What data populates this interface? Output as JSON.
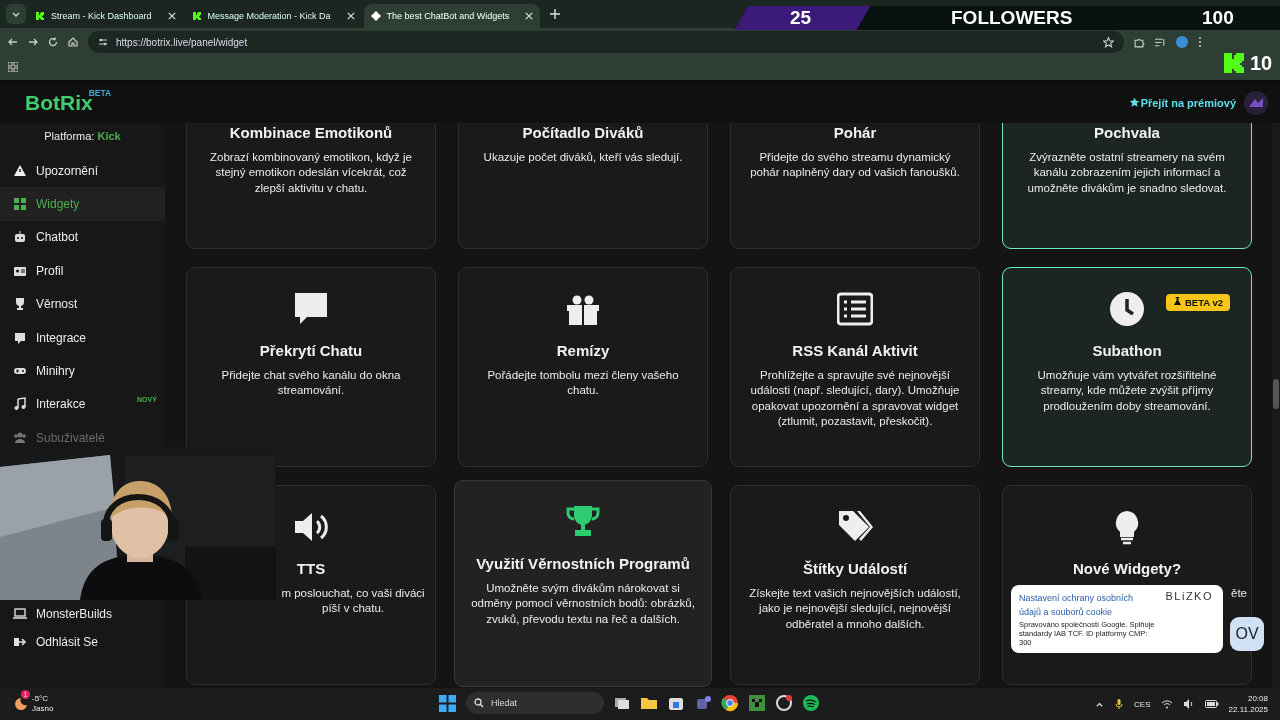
{
  "browser": {
    "tabs": [
      {
        "title": "Stream - Kick Dashboard",
        "selected": false
      },
      {
        "title": "Message Moderation - Kick Da",
        "selected": false
      },
      {
        "title": "The best ChatBot and Widgets",
        "selected": true
      }
    ],
    "url": "https://botrix.live/panel/widget"
  },
  "follower_goal": {
    "current": "25",
    "label": "FOLLOWERS",
    "target": "100",
    "level": 0.25
  },
  "kick_counter": {
    "value": "10"
  },
  "header": {
    "logo": "BotRix",
    "logo_badge": "BETA",
    "premium_link": "Přejít na prémiový"
  },
  "sidebar": {
    "platform_label": "Platforma:",
    "platform": "Kick",
    "items": [
      {
        "label": "Upozornění",
        "selected": false,
        "disabled": false
      },
      {
        "label": "Widgety",
        "selected": true,
        "disabled": false
      },
      {
        "label": "Chatbot",
        "selected": false,
        "disabled": false
      },
      {
        "label": "Profil",
        "selected": false,
        "disabled": false
      },
      {
        "label": "Věrnost",
        "selected": false,
        "disabled": false
      },
      {
        "label": "Integrace",
        "selected": false,
        "disabled": false
      },
      {
        "label": "Minihry",
        "selected": false,
        "disabled": false
      },
      {
        "label": "Interakce",
        "selected": false,
        "disabled": false,
        "badge": "NOVÝ"
      },
      {
        "label": "Subuživatelé",
        "selected": false,
        "disabled": true
      },
      {
        "label": "MonsterBuilds",
        "selected": false,
        "disabled": false
      },
      {
        "label": "Odhlásit Se",
        "selected": false,
        "disabled": false
      }
    ]
  },
  "cards": [
    {
      "title": "Kombinace Emotikonů",
      "description": "Zobrazí kombinovaný emotikon, když je stejný emotikon odeslán vícekrát, což zlepší aktivitu v chatu.",
      "highlighted": false,
      "hovered": false
    },
    {
      "title": "Počítadlo Diváků",
      "description": "Ukazuje počet diváků, kteří vás sledují.",
      "highlighted": false,
      "hovered": false
    },
    {
      "title": "Pohár",
      "description": "Přidejte do svého streamu dynamický pohár naplněný dary od vašich fanoušků.",
      "highlighted": false,
      "hovered": false
    },
    {
      "title": "Pochvala",
      "description": "Zvýrazněte ostatní streamery na svém kanálu zobrazením jejich informací a umožněte divákům je snadno sledovat.",
      "highlighted": true,
      "hovered": false
    },
    {
      "title": "Překrytí Chatu",
      "description": "Přidejte chat svého kanálu do okna streamování.",
      "highlighted": false,
      "hovered": false
    },
    {
      "title": "Remízy",
      "description": "Pořádejte tombolu mezi členy vašeho chatu.",
      "highlighted": false,
      "hovered": false
    },
    {
      "title": "RSS Kanál Aktivit",
      "description": "Prohlížejte a spravujte své nejnovější události (např. sledující, dary). Umožňuje opakovat upozornění a spravovat widget (ztlumit, pozastavit, přeskočit).",
      "highlighted": false,
      "hovered": false
    },
    {
      "title": "Subathon",
      "description": "Umožňuje vám vytvářet rozšiřitelné streamy, kde můžete zvýšit příjmy prodloužením doby streamování.",
      "highlighted": true,
      "hovered": false,
      "badge": "BETA v2"
    },
    {
      "title": "TTS",
      "description": "m poslouchat, co vaši diváci píší v chatu.",
      "highlighted": false,
      "hovered": false
    },
    {
      "title": "Využití Věrnostních Programů",
      "description": "Umožněte svým divákům nárokovat si odměny pomocí věrnostních bodů: obrázků, zvuků, převodu textu na řeč a dalších.",
      "highlighted": false,
      "hovered": true
    },
    {
      "title": "Štítky Událostí",
      "description": "Získejte text vašich nejnovějších událostí, jako je nejnovější sledující, nejnovější odběratel a mnoho dalších.",
      "highlighted": false,
      "hovered": false
    },
    {
      "title": "Nové Widgety?",
      "description": "ěte",
      "highlighted": false,
      "hovered": false
    }
  ],
  "cookie_notice": {
    "title": "Nastavení ochrany osobních údajů a souborů cookie",
    "brand": "BLiZKO",
    "body": "Spravováno společností Google. Splňuje standardy IAB TCF. ID platformy CMP: 300",
    "badge": "OV"
  },
  "taskbar": {
    "temperature": "-5°C",
    "weather": "Jasno",
    "weather_badge": "1",
    "search_placeholder": "Hledat",
    "language": "CES",
    "time": "20:08",
    "date": "22.11.2025"
  }
}
